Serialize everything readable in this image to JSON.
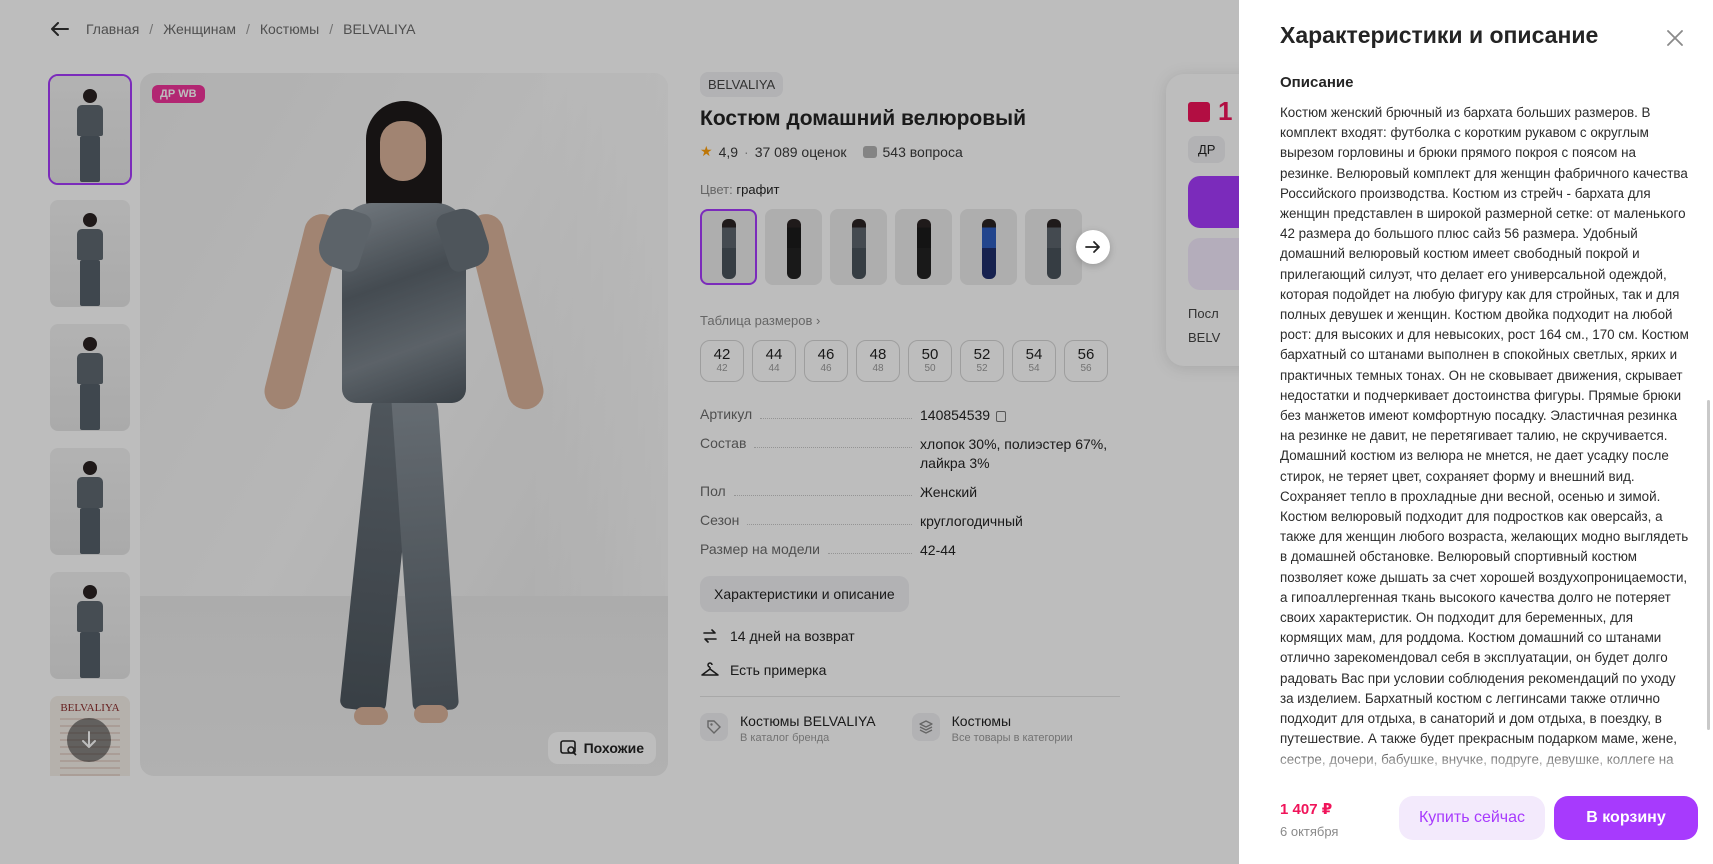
{
  "breadcrumbs": [
    "Главная",
    "Женщинам",
    "Костюмы",
    "BELVALIYA"
  ],
  "gallery": {
    "badge": "ДР WB",
    "similar_label": "Похожие",
    "doc_brand": "BELVALIYA"
  },
  "product": {
    "brand": "BELVALIYA",
    "title": "Костюм домашний велюровый",
    "rating": "4,9",
    "reviews": "37 089 оценок",
    "questions": "543 вопроса",
    "color_label": "Цвет:",
    "color_value": "графит",
    "sizes_label": "Таблица размеров",
    "sizes": [
      {
        "n": "42",
        "m": "42"
      },
      {
        "n": "44",
        "m": "44"
      },
      {
        "n": "46",
        "m": "46"
      },
      {
        "n": "48",
        "m": "48"
      },
      {
        "n": "50",
        "m": "50"
      },
      {
        "n": "52",
        "m": "52"
      },
      {
        "n": "54",
        "m": "54"
      },
      {
        "n": "56",
        "m": "56"
      }
    ],
    "specs": [
      {
        "k": "Артикул",
        "v": "140854539"
      },
      {
        "k": "Состав",
        "v": "хлопок 30%, полиэстер 67%, лайкра 3%"
      },
      {
        "k": "Пол",
        "v": "Женский"
      },
      {
        "k": "Сезон",
        "v": "круглогодичный"
      },
      {
        "k": "Размер на модели",
        "v": "42-44"
      }
    ],
    "char_button": "Характеристики и описание",
    "perks": [
      "14 дней на возврат",
      "Есть примерка"
    ],
    "links": [
      {
        "title": "Костюмы BELVALIYA",
        "sub": "В каталог бренда"
      },
      {
        "title": "Костюмы",
        "sub": "Все товары в категории"
      }
    ]
  },
  "buy_card": {
    "price": "1",
    "dr": "ДР",
    "row1": "Посл",
    "row2": "BELV"
  },
  "panel": {
    "title": "Характеристики и описание",
    "section": "Описание",
    "description": "Костюм женский брючный из бархата больших размеров. В комплект входят: футболка с коротким рукавом с округлым вырезом горловины и брюки прямого покроя с поясом на резинке. Велюровый комплект для женщин фабричного качества Российского производства. Костюм из стрейч - бархата для женщин представлен в широкой размерной сетке: от маленького 42 размера до большого плюс сайз 56 размера. Удобный домашний велюровый костюм имеет свободный покрой и прилегающий силуэт, что делает его универсальной одеждой, которая подойдет на любую фигуру как для стройных, так и для полных девушек и женщин. Костюм двойка подходит на любой рост: для высоких и для невысоких, рост 164 см., 170 см. Костюм бархатный со штанами выполнен в спокойных светлых, ярких и практичных темных тонах. Он не сковывает движения, скрывает недостатки и подчеркивает достоинства фигуры. Прямые брюки без манжетов имеют комфортную посадку. Эластичная резинка на резинке не давит, не перетягивает талию, не скручивается. Домашний костюм из велюра не мнется, не дает усадку после стирок, не теряет цвет, сохраняет форму и внешний вид. Сохраняет тепло в прохладные дни весной, осенью и зимой. Костюм велюровый подходит для подростков как оверсайз, а также для женщин любого возраста, желающих модно выглядеть в домашней обстановке. Велюровый спортивный костюм позволяет коже дышать за счет хорошей воздухопроницаемости, а гипоаллергенная ткань высокого качества долго не потеряет своих характеристик. Он подходит для беременных, для кормящих мам, для роддома. Костюм домашний со штанами отлично зарекомендовал себя в эксплуатации, он будет долго радовать Вас при условии соблюдения рекомендаций по уходу за изделием. Бархатный костюм с леггинсами также отлично подходит для отдыха, в санаторий и дом отдыха, в поездку, в путешествие. А также будет прекрасным подарком маме, жене, сестре, дочери, бабушке, внучке, подруге, девушке, коллеге на",
    "footer_price": "1 407 ₽",
    "footer_date": "6 октября",
    "buy_now": "Купить сейчас",
    "add_to_cart": "В корзину"
  },
  "colors": {
    "accent": "#a73afd",
    "price": "#f0145a",
    "badge": "#f0349a"
  }
}
